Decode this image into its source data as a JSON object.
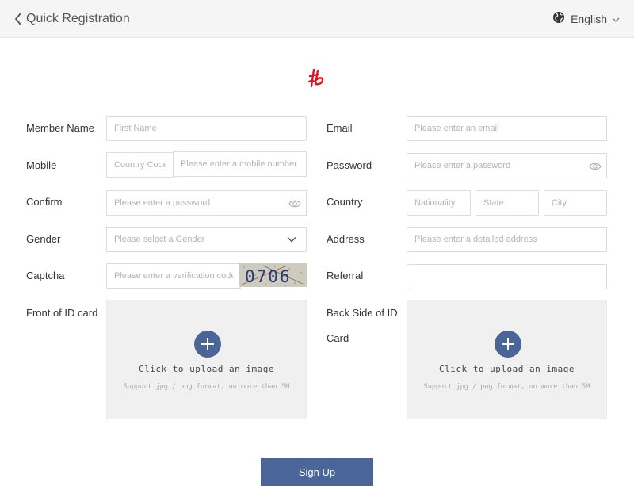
{
  "header": {
    "back_icon": "chevron-left-icon",
    "title": "Quick Registration",
    "language_icon": "globe-icon",
    "language": "English",
    "language_dropdown_icon": "chevron-down-icon"
  },
  "logo": {
    "icon": "brand-logo-icon",
    "color": "#e0141e"
  },
  "form": {
    "member_name": {
      "label": "Member Name",
      "placeholder": "First Name",
      "value": ""
    },
    "email": {
      "label": "Email",
      "placeholder": "Please enter an email",
      "value": ""
    },
    "mobile": {
      "label": "Mobile",
      "country_code_placeholder": "Country Code",
      "number_placeholder": "Please enter a mobile number"
    },
    "password": {
      "label": "Password",
      "placeholder": "Please enter a password",
      "icon": "eye-icon"
    },
    "confirm": {
      "label": "Confirm",
      "placeholder": "Please enter a password",
      "icon": "eye-icon"
    },
    "country": {
      "label": "Country",
      "nationality_placeholder": "Nationality",
      "state_placeholder": "State",
      "city_placeholder": "City"
    },
    "gender": {
      "label": "Gender",
      "placeholder": "Please select a Gender",
      "icon": "chevron-down-icon"
    },
    "address": {
      "label": "Address",
      "placeholder": "Please enter a detailed address"
    },
    "captcha": {
      "label": "Captcha",
      "placeholder": "Please enter a verification code",
      "code": "0706"
    },
    "referral": {
      "label": "Referral",
      "placeholder": ""
    },
    "front_id": {
      "label": "Front of ID card",
      "upload_text": "Click to upload an image",
      "hint": "Support jpg / png format, no more than 5M",
      "icon": "plus-icon"
    },
    "back_id": {
      "label_line1": "Back Side of ID",
      "label_line2": "Card",
      "upload_text": "Click to upload an image",
      "hint": "Support jpg / png format, no more than 5M",
      "icon": "plus-icon"
    }
  },
  "signup_label": "Sign Up",
  "colors": {
    "accent": "#4a6698",
    "header_bg": "#f5f5f5",
    "upload_bg": "#f0f0f0",
    "brand": "#e0141e"
  }
}
